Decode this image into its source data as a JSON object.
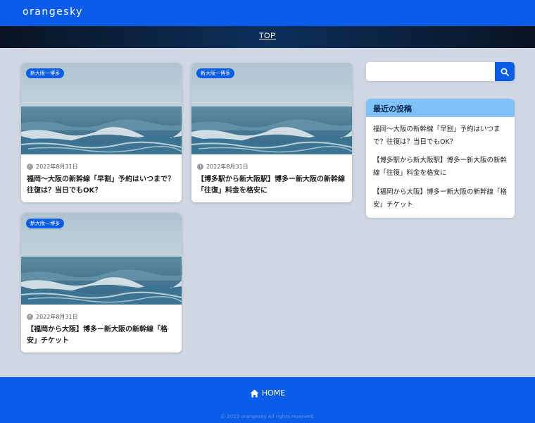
{
  "header": {
    "logo": "orangesky"
  },
  "nav": {
    "top_label": "TOP"
  },
  "posts": [
    {
      "category": "新大阪ー博多",
      "date": "2022年8月31日",
      "title": "福岡〜大阪の新幹線「早割」予約はいつまで？往復は？当日でもOK？"
    },
    {
      "category": "新大阪ー博多",
      "date": "2022年8月31日",
      "title": "【博多駅から新大阪駅】博多ー新大阪の新幹線「往復」料金を格安に"
    },
    {
      "category": "新大阪ー博多",
      "date": "2022年8月31日",
      "title": "【福岡から大阪】博多ー新大阪の新幹線「格安」チケット"
    }
  ],
  "search": {
    "placeholder": "",
    "value": ""
  },
  "sidebar": {
    "heading": "最近の投稿",
    "recent": [
      "福岡〜大阪の新幹線「早割」予約はいつまで？往復は？当日でもOK？",
      "【博多駅から新大阪駅】博多ー新大阪の新幹線「往復」料金を格安に",
      "【福岡から大阪】博多ー新大阪の新幹線「格安」チケット"
    ]
  },
  "footer": {
    "home_label": "HOME",
    "copyright": "© 2023 orangesky All rights reserved."
  },
  "colors": {
    "primary": "#0b5ce8",
    "widget_header": "#7fc2f5",
    "background": "#d0d6e2"
  },
  "icons": {
    "search": "search-icon",
    "home": "home-icon",
    "clock": "clock-icon"
  }
}
